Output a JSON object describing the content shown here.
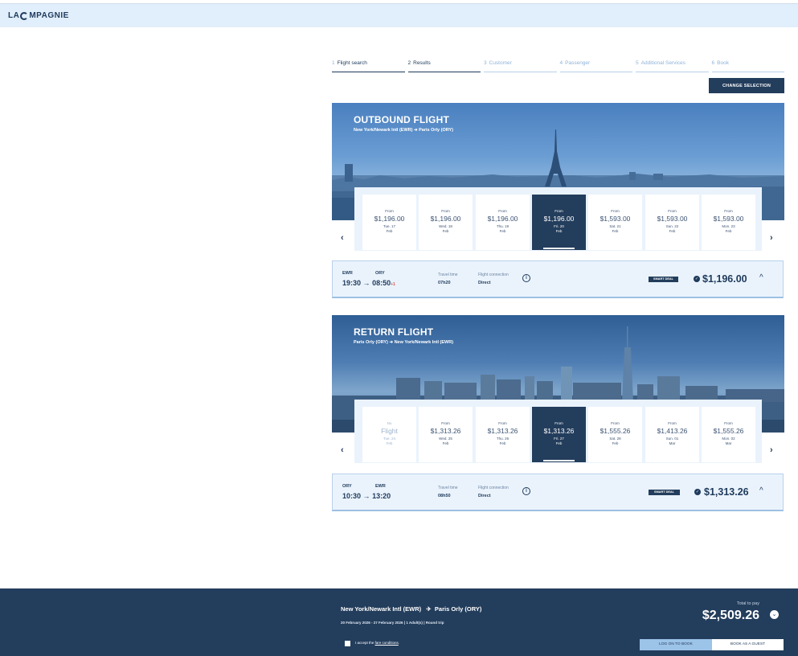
{
  "brand": {
    "logo_left": "LA ",
    "logo_right": "MPAGNIE"
  },
  "steps": [
    {
      "n": "1",
      "label": "Flight search"
    },
    {
      "n": "2",
      "label": "Results"
    },
    {
      "n": "3",
      "label": "Customer"
    },
    {
      "n": "4",
      "label": "Passenger"
    },
    {
      "n": "5",
      "label": "Additional Services"
    },
    {
      "n": "6",
      "label": "Book"
    }
  ],
  "change_selection": "CHANGE SELECTION",
  "outbound": {
    "title": "OUTBOUND FLIGHT",
    "from": "New York/Newark Intl (EWR)",
    "to": "Paris Orly (ORY)",
    "dates": [
      {
        "from": "From",
        "price": "$1,196.00",
        "day": "Tue. 17",
        "month": "Feb"
      },
      {
        "from": "From",
        "price": "$1,196.00",
        "day": "Wed. 18",
        "month": "Feb"
      },
      {
        "from": "From",
        "price": "$1,196.00",
        "day": "Thu. 19",
        "month": "Feb"
      },
      {
        "from": "From",
        "price": "$1,196.00",
        "day": "Fri. 20",
        "month": "Feb"
      },
      {
        "from": "From",
        "price": "$1,593.00",
        "day": "Sat. 21",
        "month": "Feb"
      },
      {
        "from": "From",
        "price": "$1,593.00",
        "day": "Sun. 22",
        "month": "Feb"
      },
      {
        "from": "From",
        "price": "$1,593.00",
        "day": "Mon. 23",
        "month": "Feb"
      }
    ],
    "dep_iata": "EWR",
    "arr_iata": "ORY",
    "dep_time": "19:30",
    "arr_time": "08:50",
    "travel_label": "Travel time",
    "travel_time": "07h20",
    "conn_label": "Flight connection",
    "conn_value": "Direct",
    "smart_deal": "SMART DEAL",
    "price": "$1,196.00"
  },
  "return": {
    "title": "RETURN FLIGHT",
    "from": "Paris Orly (ORY)",
    "to": "New York/Newark Intl (EWR)",
    "dates": [
      {
        "from": "No",
        "price": "Flight",
        "day": "Tue. 24",
        "month": "Feb"
      },
      {
        "from": "From",
        "price": "$1,313.26",
        "day": "Wed. 25",
        "month": "Feb"
      },
      {
        "from": "From",
        "price": "$1,313.26",
        "day": "Thu. 26",
        "month": "Feb"
      },
      {
        "from": "From",
        "price": "$1,313.26",
        "day": "Fri. 27",
        "month": "Feb"
      },
      {
        "from": "From",
        "price": "$1,555.26",
        "day": "Sat. 28",
        "month": "Feb"
      },
      {
        "from": "From",
        "price": "$1,413.26",
        "day": "Sun. 01",
        "month": "Mar"
      },
      {
        "from": "From",
        "price": "$1,555.26",
        "day": "Mon. 02",
        "month": "Mar"
      }
    ],
    "dep_iata": "ORY",
    "arr_iata": "EWR",
    "dep_time": "10:30",
    "arr_time": "13:20",
    "travel_label": "Travel time",
    "travel_time": "08h50",
    "conn_label": "Flight connection",
    "conn_value": "Direct",
    "smart_deal": "SMART DEAL",
    "price": "$1,313.26"
  },
  "footer": {
    "from": "New York/Newark Intl (EWR)",
    "to": "Paris Orly (ORY)",
    "dates": "20 February 2026 - 27 February 2026",
    "passengers": "1 Adult(s)",
    "trip_type": "Round trip",
    "total_label": "Total to pay",
    "total": "$2,509.26",
    "accept_prefix": "I accept the ",
    "accept_link": "fare conditions",
    "accept_suffix": ".",
    "login_btn": "LOG ON TO BOOK",
    "guest_btn": "BOOK AS A GUEST"
  }
}
